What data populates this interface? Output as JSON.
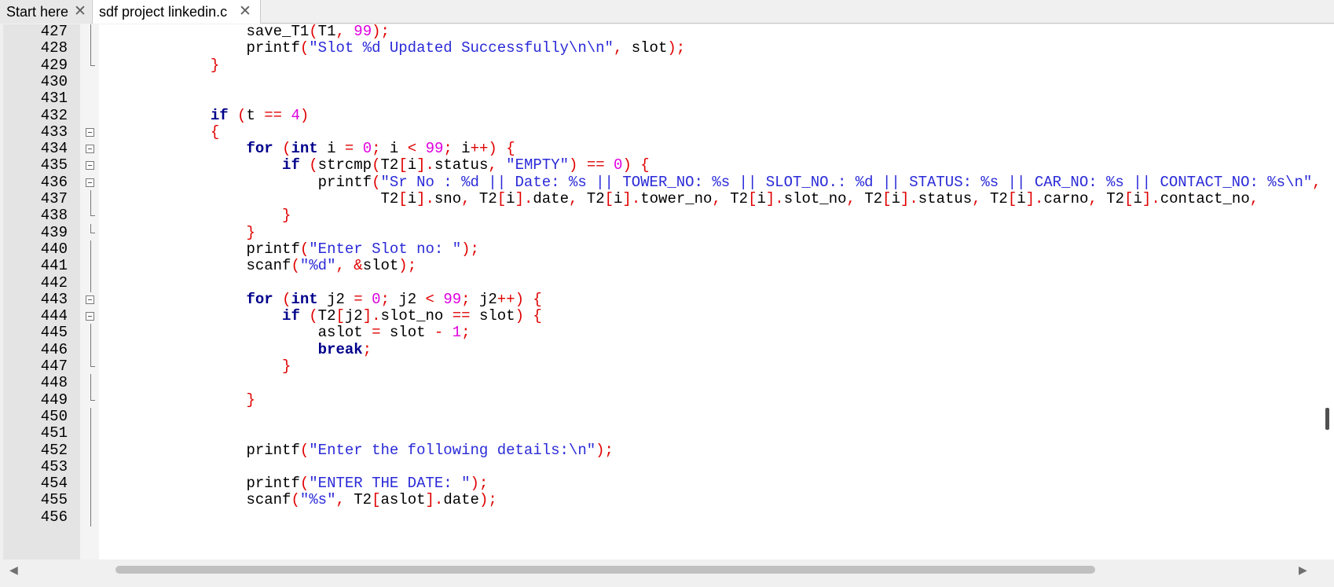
{
  "tabs": [
    {
      "label": "Start here",
      "close": "✕",
      "active": false
    },
    {
      "label": "sdf project linkedin.c",
      "close": "✕",
      "active": true
    }
  ],
  "editor": {
    "lines": [
      {
        "n": "427",
        "fold": "line",
        "tokens": [
          [
            "p",
            "                "
          ],
          [
            "p",
            "save_T1"
          ],
          [
            "o",
            "("
          ],
          [
            "p",
            "T1"
          ],
          [
            "o",
            ","
          ],
          [
            "p",
            " "
          ],
          [
            "n",
            "99"
          ],
          [
            "o",
            ")"
          ],
          [
            "o",
            ";"
          ]
        ]
      },
      {
        "n": "428",
        "fold": "line",
        "tokens": [
          [
            "p",
            "                "
          ],
          [
            "p",
            "printf"
          ],
          [
            "o",
            "("
          ],
          [
            "s",
            "\"Slot %d Updated Successfully\\n\\n\""
          ],
          [
            "o",
            ","
          ],
          [
            "p",
            " slot"
          ],
          [
            "o",
            ")"
          ],
          [
            "o",
            ";"
          ]
        ]
      },
      {
        "n": "429",
        "fold": "end",
        "tokens": [
          [
            "p",
            "            "
          ],
          [
            "o",
            "}"
          ]
        ]
      },
      {
        "n": "430",
        "fold": "",
        "tokens": []
      },
      {
        "n": "431",
        "fold": "",
        "tokens": []
      },
      {
        "n": "432",
        "fold": "",
        "tokens": [
          [
            "p",
            "            "
          ],
          [
            "k",
            "if"
          ],
          [
            "p",
            " "
          ],
          [
            "o",
            "("
          ],
          [
            "p",
            "t "
          ],
          [
            "o",
            "=="
          ],
          [
            "p",
            " "
          ],
          [
            "n",
            "4"
          ],
          [
            "o",
            ")"
          ]
        ]
      },
      {
        "n": "433",
        "fold": "box",
        "tokens": [
          [
            "p",
            "            "
          ],
          [
            "o",
            "{"
          ]
        ]
      },
      {
        "n": "434",
        "fold": "box",
        "tokens": [
          [
            "p",
            "                "
          ],
          [
            "k",
            "for"
          ],
          [
            "p",
            " "
          ],
          [
            "o",
            "("
          ],
          [
            "k",
            "int"
          ],
          [
            "p",
            " i "
          ],
          [
            "o",
            "="
          ],
          [
            "p",
            " "
          ],
          [
            "n",
            "0"
          ],
          [
            "o",
            ";"
          ],
          [
            "p",
            " i "
          ],
          [
            "o",
            "<"
          ],
          [
            "p",
            " "
          ],
          [
            "n",
            "99"
          ],
          [
            "o",
            ";"
          ],
          [
            "p",
            " i"
          ],
          [
            "o",
            "++"
          ],
          [
            "o",
            ")"
          ],
          [
            "p",
            " "
          ],
          [
            "o",
            "{"
          ]
        ]
      },
      {
        "n": "435",
        "fold": "box",
        "tokens": [
          [
            "p",
            "                    "
          ],
          [
            "k",
            "if"
          ],
          [
            "p",
            " "
          ],
          [
            "o",
            "("
          ],
          [
            "p",
            "strcmp"
          ],
          [
            "o",
            "("
          ],
          [
            "p",
            "T2"
          ],
          [
            "o",
            "["
          ],
          [
            "p",
            "i"
          ],
          [
            "o",
            "]"
          ],
          [
            "o",
            "."
          ],
          [
            "p",
            "status"
          ],
          [
            "o",
            ","
          ],
          [
            "p",
            " "
          ],
          [
            "s",
            "\"EMPTY\""
          ],
          [
            "o",
            ")"
          ],
          [
            "p",
            " "
          ],
          [
            "o",
            "=="
          ],
          [
            "p",
            " "
          ],
          [
            "n",
            "0"
          ],
          [
            "o",
            ")"
          ],
          [
            "p",
            " "
          ],
          [
            "o",
            "{"
          ]
        ]
      },
      {
        "n": "436",
        "fold": "box",
        "tokens": [
          [
            "p",
            "                        "
          ],
          [
            "p",
            "printf"
          ],
          [
            "o",
            "("
          ],
          [
            "s",
            "\"Sr No : %d || Date: %s || TOWER_NO: %s || SLOT_NO.: %d || STATUS: %s || CAR_NO: %s || CONTACT_NO: %s\\n\""
          ],
          [
            "o",
            ","
          ]
        ]
      },
      {
        "n": "437",
        "fold": "line",
        "tokens": [
          [
            "p",
            "                               "
          ],
          [
            "p",
            "T2"
          ],
          [
            "o",
            "["
          ],
          [
            "p",
            "i"
          ],
          [
            "o",
            "]"
          ],
          [
            "o",
            "."
          ],
          [
            "p",
            "sno"
          ],
          [
            "o",
            ","
          ],
          [
            "p",
            " T2"
          ],
          [
            "o",
            "["
          ],
          [
            "p",
            "i"
          ],
          [
            "o",
            "]"
          ],
          [
            "o",
            "."
          ],
          [
            "p",
            "date"
          ],
          [
            "o",
            ","
          ],
          [
            "p",
            " T2"
          ],
          [
            "o",
            "["
          ],
          [
            "p",
            "i"
          ],
          [
            "o",
            "]"
          ],
          [
            "o",
            "."
          ],
          [
            "p",
            "tower_no"
          ],
          [
            "o",
            ","
          ],
          [
            "p",
            " T2"
          ],
          [
            "o",
            "["
          ],
          [
            "p",
            "i"
          ],
          [
            "o",
            "]"
          ],
          [
            "o",
            "."
          ],
          [
            "p",
            "slot_no"
          ],
          [
            "o",
            ","
          ],
          [
            "p",
            " T2"
          ],
          [
            "o",
            "["
          ],
          [
            "p",
            "i"
          ],
          [
            "o",
            "]"
          ],
          [
            "o",
            "."
          ],
          [
            "p",
            "status"
          ],
          [
            "o",
            ","
          ],
          [
            "p",
            " T2"
          ],
          [
            "o",
            "["
          ],
          [
            "p",
            "i"
          ],
          [
            "o",
            "]"
          ],
          [
            "o",
            "."
          ],
          [
            "p",
            "carno"
          ],
          [
            "o",
            ","
          ],
          [
            "p",
            " T2"
          ],
          [
            "o",
            "["
          ],
          [
            "p",
            "i"
          ],
          [
            "o",
            "]"
          ],
          [
            "o",
            "."
          ],
          [
            "p",
            "contact_no"
          ],
          [
            "o",
            ","
          ]
        ]
      },
      {
        "n": "438",
        "fold": "end",
        "tokens": [
          [
            "p",
            "                    "
          ],
          [
            "o",
            "}"
          ]
        ]
      },
      {
        "n": "439",
        "fold": "end",
        "tokens": [
          [
            "p",
            "                "
          ],
          [
            "o",
            "}"
          ]
        ]
      },
      {
        "n": "440",
        "fold": "line",
        "tokens": [
          [
            "p",
            "                "
          ],
          [
            "p",
            "printf"
          ],
          [
            "o",
            "("
          ],
          [
            "s",
            "\"Enter Slot no: \""
          ],
          [
            "o",
            ")"
          ],
          [
            "o",
            ";"
          ]
        ]
      },
      {
        "n": "441",
        "fold": "line",
        "tokens": [
          [
            "p",
            "                "
          ],
          [
            "p",
            "scanf"
          ],
          [
            "o",
            "("
          ],
          [
            "s",
            "\"%d\""
          ],
          [
            "o",
            ","
          ],
          [
            "p",
            " "
          ],
          [
            "o",
            "&"
          ],
          [
            "p",
            "slot"
          ],
          [
            "o",
            ")"
          ],
          [
            "o",
            ";"
          ]
        ]
      },
      {
        "n": "442",
        "fold": "line",
        "tokens": []
      },
      {
        "n": "443",
        "fold": "box",
        "tokens": [
          [
            "p",
            "                "
          ],
          [
            "k",
            "for"
          ],
          [
            "p",
            " "
          ],
          [
            "o",
            "("
          ],
          [
            "k",
            "int"
          ],
          [
            "p",
            " j2 "
          ],
          [
            "o",
            "="
          ],
          [
            "p",
            " "
          ],
          [
            "n",
            "0"
          ],
          [
            "o",
            ";"
          ],
          [
            "p",
            " j2 "
          ],
          [
            "o",
            "<"
          ],
          [
            "p",
            " "
          ],
          [
            "n",
            "99"
          ],
          [
            "o",
            ";"
          ],
          [
            "p",
            " j2"
          ],
          [
            "o",
            "++"
          ],
          [
            "o",
            ")"
          ],
          [
            "p",
            " "
          ],
          [
            "o",
            "{"
          ]
        ]
      },
      {
        "n": "444",
        "fold": "box",
        "tokens": [
          [
            "p",
            "                    "
          ],
          [
            "k",
            "if"
          ],
          [
            "p",
            " "
          ],
          [
            "o",
            "("
          ],
          [
            "p",
            "T2"
          ],
          [
            "o",
            "["
          ],
          [
            "p",
            "j2"
          ],
          [
            "o",
            "]"
          ],
          [
            "o",
            "."
          ],
          [
            "p",
            "slot_no "
          ],
          [
            "o",
            "=="
          ],
          [
            "p",
            " slot"
          ],
          [
            "o",
            ")"
          ],
          [
            "p",
            " "
          ],
          [
            "o",
            "{"
          ]
        ]
      },
      {
        "n": "445",
        "fold": "line",
        "tokens": [
          [
            "p",
            "                        "
          ],
          [
            "p",
            "aslot "
          ],
          [
            "o",
            "="
          ],
          [
            "p",
            " slot "
          ],
          [
            "o",
            "-"
          ],
          [
            "p",
            " "
          ],
          [
            "n",
            "1"
          ],
          [
            "o",
            ";"
          ]
        ]
      },
      {
        "n": "446",
        "fold": "line",
        "tokens": [
          [
            "p",
            "                        "
          ],
          [
            "k",
            "break"
          ],
          [
            "o",
            ";"
          ]
        ]
      },
      {
        "n": "447",
        "fold": "end",
        "tokens": [
          [
            "p",
            "                    "
          ],
          [
            "o",
            "}"
          ]
        ]
      },
      {
        "n": "448",
        "fold": "line",
        "tokens": []
      },
      {
        "n": "449",
        "fold": "end",
        "tokens": [
          [
            "p",
            "                "
          ],
          [
            "o",
            "}"
          ]
        ]
      },
      {
        "n": "450",
        "fold": "line",
        "tokens": []
      },
      {
        "n": "451",
        "fold": "line",
        "tokens": []
      },
      {
        "n": "452",
        "fold": "line",
        "tokens": [
          [
            "p",
            "                "
          ],
          [
            "p",
            "printf"
          ],
          [
            "o",
            "("
          ],
          [
            "s",
            "\"Enter the following details:\\n\""
          ],
          [
            "o",
            ")"
          ],
          [
            "o",
            ";"
          ]
        ]
      },
      {
        "n": "453",
        "fold": "line",
        "tokens": []
      },
      {
        "n": "454",
        "fold": "line",
        "tokens": [
          [
            "p",
            "                "
          ],
          [
            "p",
            "printf"
          ],
          [
            "o",
            "("
          ],
          [
            "s",
            "\"ENTER THE DATE: \""
          ],
          [
            "o",
            ")"
          ],
          [
            "o",
            ";"
          ]
        ]
      },
      {
        "n": "455",
        "fold": "line",
        "tokens": [
          [
            "p",
            "                "
          ],
          [
            "p",
            "scanf"
          ],
          [
            "o",
            "("
          ],
          [
            "s",
            "\"%s\""
          ],
          [
            "o",
            ","
          ],
          [
            "p",
            " T2"
          ],
          [
            "o",
            "["
          ],
          [
            "p",
            "aslot"
          ],
          [
            "o",
            "]"
          ],
          [
            "o",
            "."
          ],
          [
            "p",
            "date"
          ],
          [
            "o",
            ")"
          ],
          [
            "o",
            ";"
          ]
        ]
      },
      {
        "n": "456",
        "fold": "line",
        "tokens": []
      }
    ]
  },
  "scrollbars": {
    "left_arrow": "◀",
    "right_arrow": "▶",
    "horizontal_thumb_fraction": 0.74
  },
  "colors": {
    "keyword": "#00008b",
    "string": "#2a2ad8",
    "number": "#e000e0",
    "operator": "#e00000"
  }
}
